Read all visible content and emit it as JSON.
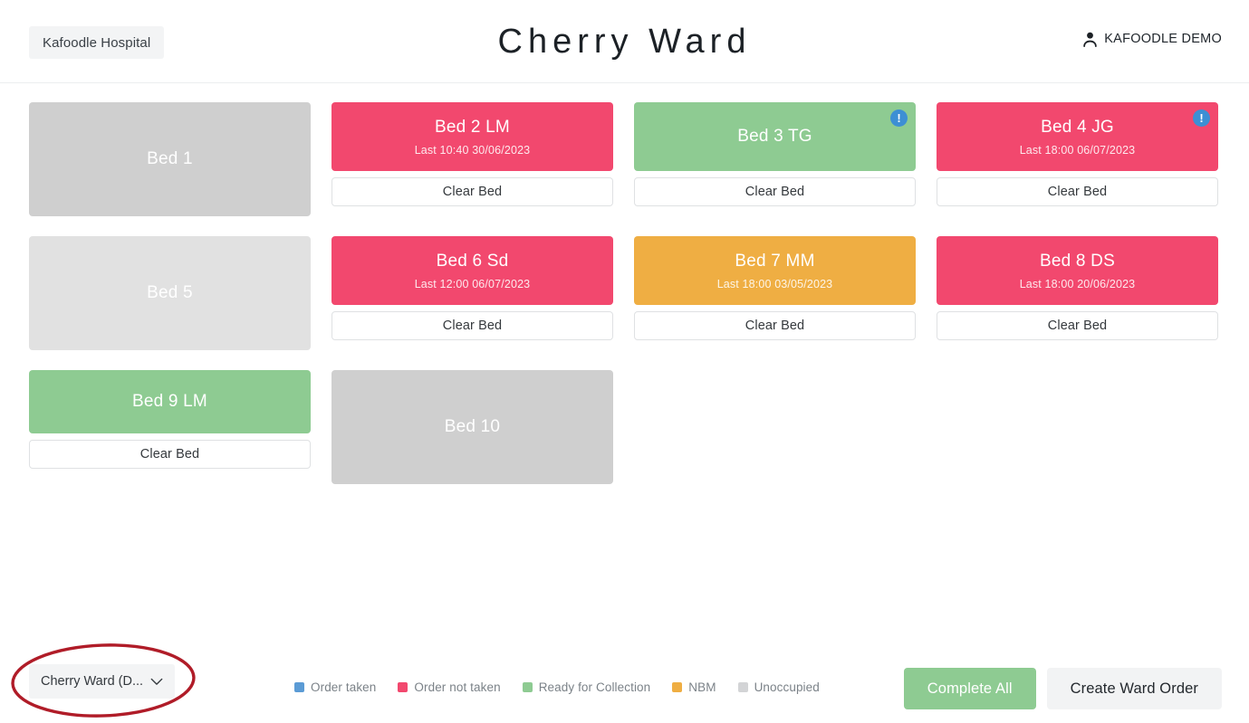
{
  "header": {
    "hospital_chip": "Kafoodle Hospital",
    "ward_title": "Cherry Ward",
    "user_icon": "person-icon",
    "user_name": "KAFOODLE DEMO"
  },
  "colors": {
    "order_taken": "#5B9BD5",
    "order_not_taken": "#F2486E",
    "ready_for_collection": "#8ECB92",
    "nbm": "#EFAE43",
    "unoccupied": "#CFCFCF",
    "unoccupied_light": "#E1E1E1",
    "alert_badge": "#3D8FD4",
    "annotation": "#B01C28"
  },
  "beds": [
    {
      "name": "Bed 1",
      "status": "Unoccupied",
      "color": "#CFCFCF",
      "last": null,
      "alert": false,
      "clear_label": null,
      "height": "h-tall"
    },
    {
      "name": "Bed 2 LM",
      "status": "Order not taken",
      "color": "#F2486E",
      "last": "Last 10:40 30/06/2023",
      "alert": false,
      "clear_label": "Clear Bed",
      "height": "h-short"
    },
    {
      "name": "Bed 3 TG",
      "status": "Ready for Collection",
      "color": "#8ECB92",
      "last": null,
      "alert": true,
      "clear_label": "Clear Bed",
      "height": "h-short"
    },
    {
      "name": "Bed 4 JG",
      "status": "Order not taken",
      "color": "#F2486E",
      "last": "Last 18:00 06/07/2023",
      "alert": true,
      "clear_label": "Clear Bed",
      "height": "h-short"
    },
    {
      "name": "Bed 5",
      "status": "Unoccupied",
      "color": "#E1E1E1",
      "last": null,
      "alert": false,
      "clear_label": null,
      "height": "h-tall"
    },
    {
      "name": "Bed 6 Sd",
      "status": "Order not taken",
      "color": "#F2486E",
      "last": "Last 12:00 06/07/2023",
      "alert": false,
      "clear_label": "Clear Bed",
      "height": "h-short"
    },
    {
      "name": "Bed 7 MM",
      "status": "NBM",
      "color": "#EFAE43",
      "last": "Last 18:00 03/05/2023",
      "alert": false,
      "clear_label": "Clear Bed",
      "height": "h-short"
    },
    {
      "name": "Bed 8 DS",
      "status": "Order not taken",
      "color": "#F2486E",
      "last": "Last 18:00 20/06/2023",
      "alert": false,
      "clear_label": "Clear Bed",
      "height": "h-short"
    },
    {
      "name": "Bed 9 LM",
      "status": "Ready for Collection",
      "color": "#8ECB92",
      "last": null,
      "alert": false,
      "clear_label": "Clear Bed",
      "height": "h-mid"
    },
    {
      "name": "Bed 10",
      "status": "Unoccupied",
      "color": "#CFCFCF",
      "last": null,
      "alert": false,
      "clear_label": null,
      "height": "h-tall"
    }
  ],
  "footer": {
    "ward_select_value": "Cherry Ward (D...",
    "ward_select_icon": "chevron-down-icon",
    "legend": [
      {
        "label": "Order taken",
        "color": "#5B9BD5"
      },
      {
        "label": "Order not taken",
        "color": "#F2486E"
      },
      {
        "label": "Ready for Collection",
        "color": "#8ECB92"
      },
      {
        "label": "NBM",
        "color": "#EFAE43"
      },
      {
        "label": "Unoccupied",
        "color": "#D3D4D6"
      }
    ],
    "complete_all_label": "Complete All",
    "create_ward_order_label": "Create Ward Order"
  },
  "annotation": {
    "shape": "ellipse-highlight",
    "target": "ward-select"
  }
}
